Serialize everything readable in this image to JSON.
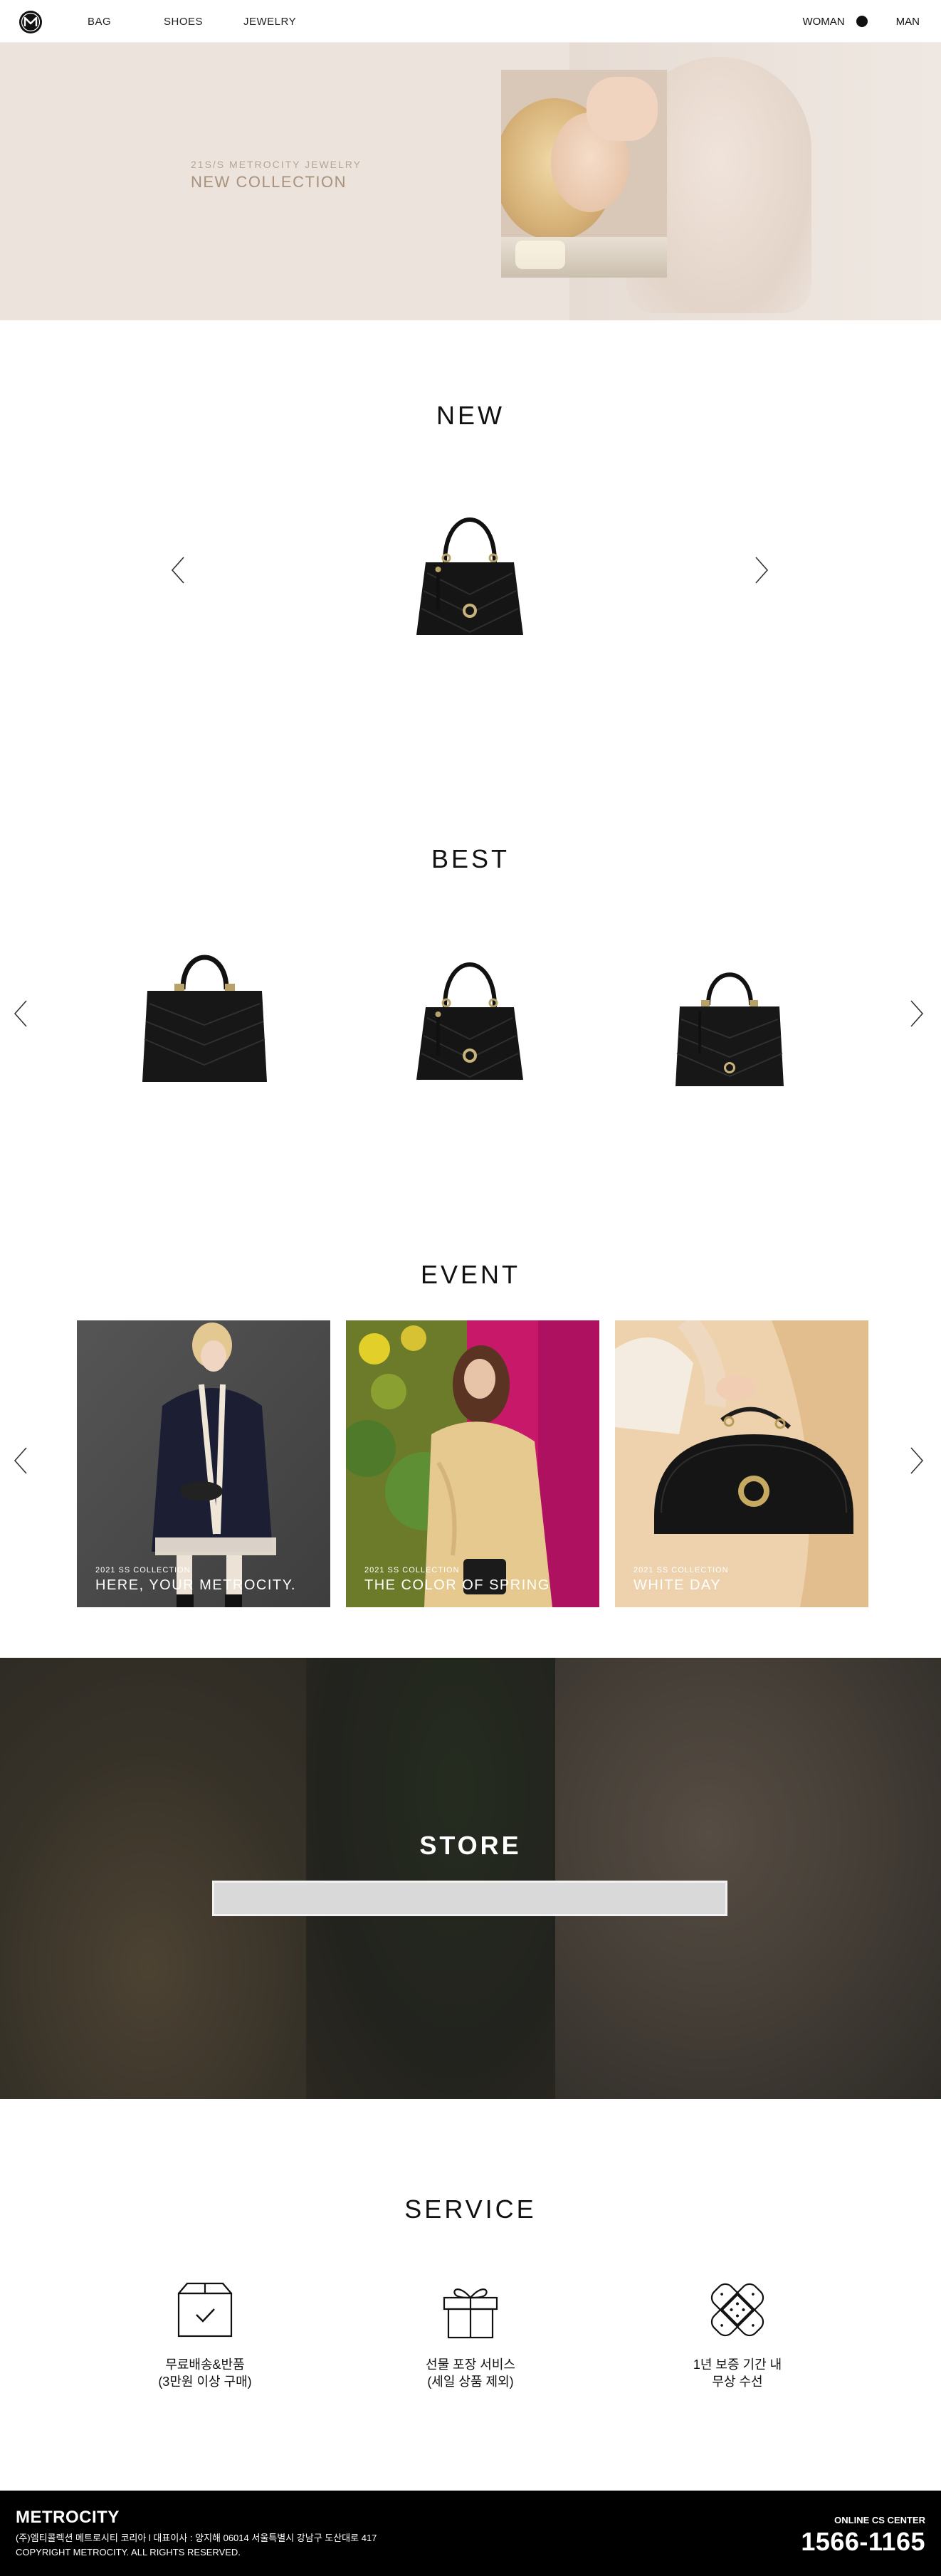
{
  "header": {
    "nav": [
      "BAG",
      "SHOES",
      "JEWELRY"
    ],
    "gender_woman": "WOMAN",
    "gender_man": "MAN",
    "gender_selected": "WOMAN"
  },
  "hero": {
    "eyebrow": "21S/S METROCITY JEWELRY",
    "title": "NEW COLLECTION"
  },
  "new_section": {
    "title": "NEW"
  },
  "best_section": {
    "title": "BEST"
  },
  "event_section": {
    "title": "EVENT",
    "cards": [
      {
        "tag": "2021 SS COLLECTION",
        "caption": "HERE, YOUR METROCITY."
      },
      {
        "tag": "2021 SS COLLECTION",
        "caption": "THE COLOR OF SPRING"
      },
      {
        "tag": "2021 SS COLLECTION",
        "caption": "WHITE DAY"
      }
    ]
  },
  "store_section": {
    "title": "STORE",
    "search_value": ""
  },
  "service_section": {
    "title": "SERVICE",
    "items": [
      {
        "icon": "delivery-box-icon",
        "label": "무료배송&반품\n(3만원 이상 구매)"
      },
      {
        "icon": "gift-box-icon",
        "label": "선물 포장 서비스\n(세일 상품 제외)"
      },
      {
        "icon": "repair-bandage-icon",
        "label": "1년 보증 기간 내\n무상 수선"
      }
    ]
  },
  "footer": {
    "brand": "METROCITY",
    "info_line1": "(주)엠티콜렉션 메트로시티 코리아 l 대표이사 : 양지해 06014 서울특별시 강남구 도산대로 417",
    "info_line2": "COPYRIGHT METROCITY. ALL RIGHTS RESERVED.",
    "cs_label": "ONLINE CS CENTER",
    "cs_number": "1566-1165"
  },
  "colors": {
    "hero_bg": "#ece3dc",
    "hero_text": "#a8917d",
    "footer_bg": "#000000"
  }
}
